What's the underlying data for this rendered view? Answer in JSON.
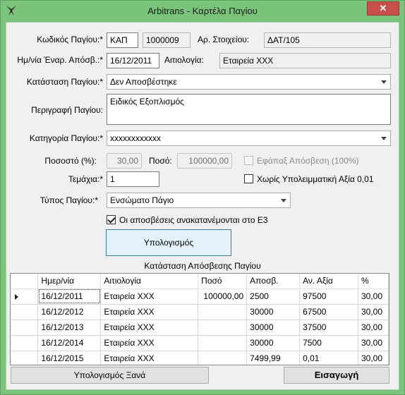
{
  "window": {
    "title": "Arbitrans - Καρτέλα Παγίου",
    "close_glyph": "✕"
  },
  "form": {
    "code_label": "Κωδικός Παγίου:*",
    "code_value": "ΚΑΠ",
    "code_number": "1000009",
    "doc_no_label": "Αρ. Στοιχείου:",
    "doc_no_value": "ΔΑΤ/105",
    "start_date_label": "Ημ/νία Έναρ. Απόσβ.:*",
    "start_date_value": "16/12/2011",
    "reason_label": "Αιτιολογία:",
    "reason_value": "Εταιρεία ΧΧΧ",
    "status_label": "Κατάσταση Παγίου:*",
    "status_value": "Δεν Αποσβέστηκε",
    "description_label": "Περιγραφή Παγίου:",
    "description_value": "Ειδικός Εξοπλισμός",
    "category_label": "Κατηγορία Παγίου:*",
    "category_value": "xxxxxxxxxxxx",
    "percent_label": "Ποσοστό (%):",
    "percent_value": "30,00",
    "amount_label": "Ποσό:",
    "amount_value": "100000,00",
    "one_off_label": "Εφάπαξ Απόσβεση (100%)",
    "one_off_checked": false,
    "pieces_label": "Τεμάχια:*",
    "pieces_value": "1",
    "no_residual_label": "Χωρίς Υπολειμματική Αξία 0,01",
    "no_residual_checked": false,
    "type_label": "Τύπος Παγίου:*",
    "type_value": "Ενσώματο Πάγιο",
    "e3_label": "Οι αποσβέσεις ανακατανέμονται στο Ε3",
    "e3_checked": true,
    "calculate_button": "Υπολογισμός"
  },
  "schedule": {
    "title": "Κατάσταση Απόσβεσης Παγίου",
    "columns": [
      "Ημερ/νία",
      "Αιτιολογία",
      "Ποσό",
      "Αποσβ.",
      "Αν. Αξία",
      "%"
    ],
    "rows": [
      [
        "16/12/2011",
        "Εταιρεία ΧΧΧ",
        "100000,00",
        "2500",
        "97500",
        "30,00"
      ],
      [
        "16/12/2012",
        "Εταιρεία ΧΧΧ",
        "",
        "30000",
        "67500",
        "30,00"
      ],
      [
        "16/12/2013",
        "Εταιρεία ΧΧΧ",
        "",
        "30000",
        "37500",
        "30,00"
      ],
      [
        "16/12/2014",
        "Εταιρεία ΧΧΧ",
        "",
        "30000",
        "7500",
        "30,00"
      ],
      [
        "16/12/2015",
        "Εταιρεία ΧΧΧ",
        "",
        "7499,99",
        "0,01",
        "30,00"
      ]
    ]
  },
  "footer": {
    "recalculate_button": "Υπολογισμός Ξανά",
    "insert_button": "Εισαγωγή"
  },
  "colors": {
    "window_frame": "#79c47a",
    "client_bg": "#f0f0f0",
    "close_button": "#c7504a"
  }
}
